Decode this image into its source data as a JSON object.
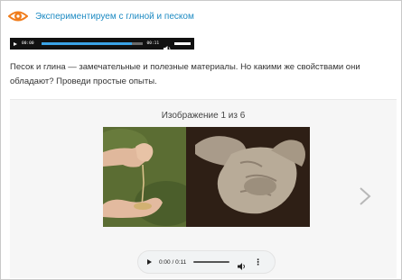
{
  "header": {
    "icon": "eye-icon",
    "accent": "#f07c1b",
    "title": "Экспериментируем с глиной и песком",
    "title_color": "#1e8bc3"
  },
  "audio_strip": {
    "current_time": "00:00",
    "duration": "00:11",
    "progress_fraction": 0.9
  },
  "description": "Песок и глина — замечательные и полезные материалы. Но какими же свойствами они обладают? Проведи простые опыты.",
  "gallery": {
    "counter": "Изображение 1 из 6",
    "next_icon": "chevron-right-icon",
    "player": {
      "time": "0:00 / 0:11",
      "menu_icon": "more-vert-icon",
      "volume_icon": "volume-icon"
    }
  }
}
